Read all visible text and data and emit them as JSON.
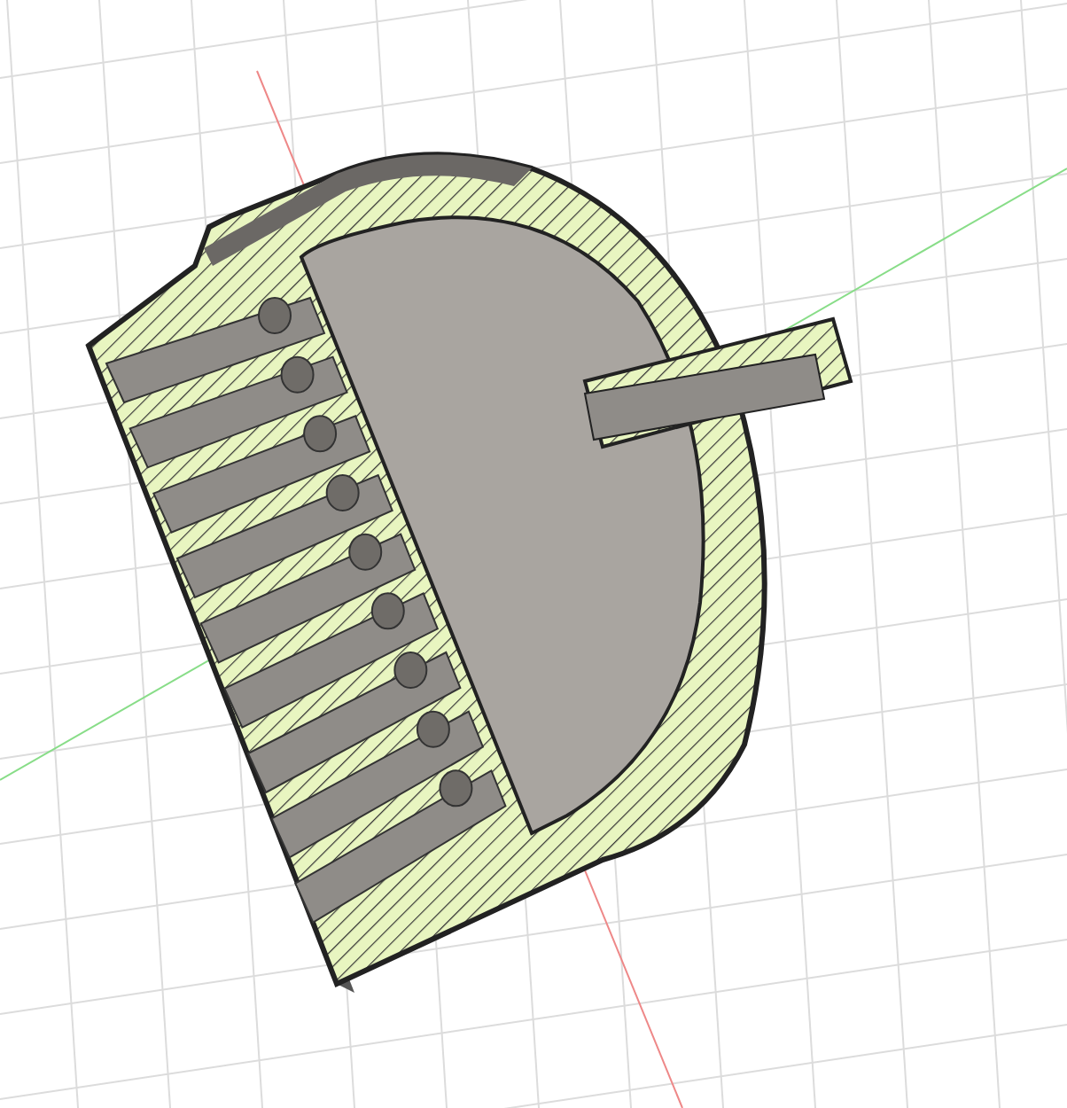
{
  "viewport": {
    "kind": "section"
  }
}
